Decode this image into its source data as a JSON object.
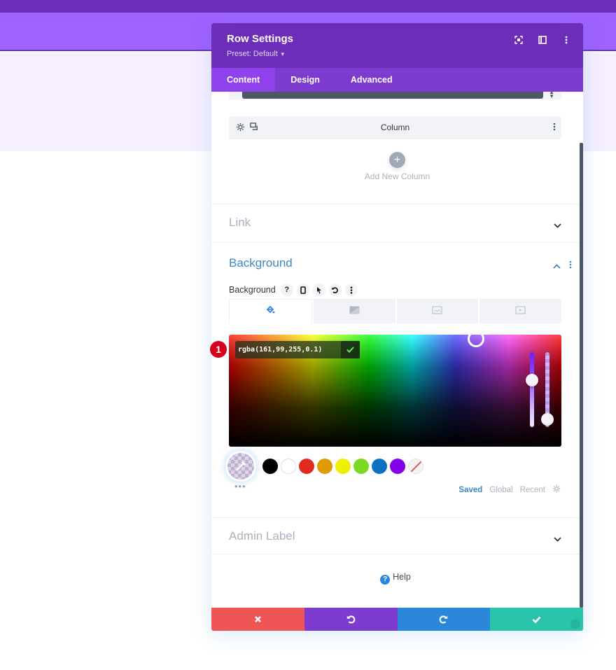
{
  "modal": {
    "title": "Row Settings",
    "preset": "Preset: Default",
    "header_icons": [
      "fullscreen-icon",
      "split-view-icon",
      "more-options-icon"
    ]
  },
  "tabs": [
    {
      "label": "Content",
      "active": true
    },
    {
      "label": "Design",
      "active": false
    },
    {
      "label": "Advanced",
      "active": false
    }
  ],
  "columns": {
    "column_label": "Column",
    "add_label": "Add New Column",
    "add_symbol": "+"
  },
  "sections": {
    "link": "Link",
    "background": "Background",
    "admin_label": "Admin Label"
  },
  "background": {
    "field_label": "Background",
    "help_symbol": "?",
    "types": [
      "color",
      "gradient",
      "image",
      "video"
    ],
    "active_type": "color",
    "color_value": "rgba(161,99,255,0.1)",
    "hue_position_percent": 37,
    "alpha": 0.1,
    "annotation_number": "1",
    "swatches": [
      {
        "name": "black",
        "color": "#000000"
      },
      {
        "name": "white",
        "color": "#ffffff"
      },
      {
        "name": "red",
        "color": "#e02b20"
      },
      {
        "name": "orange",
        "color": "#e09900"
      },
      {
        "name": "yellow",
        "color": "#edf000"
      },
      {
        "name": "green",
        "color": "#7cda24"
      },
      {
        "name": "blue",
        "color": "#0c71c3"
      },
      {
        "name": "purple",
        "color": "#8300e9"
      }
    ],
    "more_dots": "•••",
    "palette_tabs": [
      {
        "label": "Saved",
        "active": true
      },
      {
        "label": "Global",
        "active": false
      },
      {
        "label": "Recent",
        "active": false
      }
    ]
  },
  "help_label": "Help",
  "help_symbol": "?",
  "footer": {
    "cancel": "cancel",
    "undo": "undo",
    "redo": "redo",
    "save": "save"
  },
  "colors": {
    "header_purple": "#6c2eb9",
    "tab_bar": "#7d3bcf",
    "active_tab": "#8f42ec",
    "accent_blue": "#3f88c3",
    "cancel_red": "#ef5555",
    "undo_purple": "#7e3bd0",
    "redo_blue": "#2b87da",
    "save_green": "#29c4a9"
  }
}
